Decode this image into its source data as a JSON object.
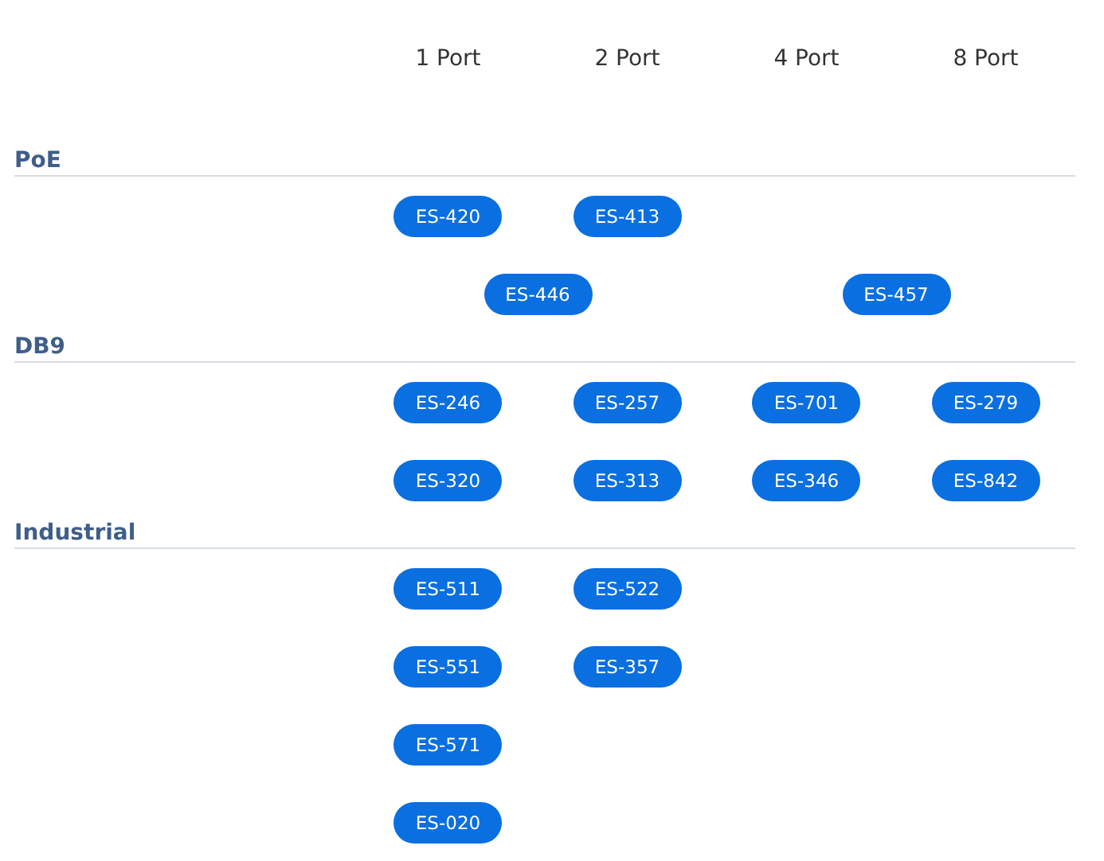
{
  "columns": [
    "1 Port",
    "2 Port",
    "4 Port",
    "8 Port"
  ],
  "sections": [
    {
      "title": "PoE",
      "rows": [
        {
          "cells": [
            {
              "kind": "single",
              "label": "ES-420"
            },
            {
              "kind": "single",
              "label": "ES-413"
            }
          ]
        },
        {
          "cells": [
            {
              "kind": "wide",
              "label": "ES-446"
            },
            {
              "kind": "wide",
              "label": "ES-457"
            }
          ]
        }
      ]
    },
    {
      "title": "DB9",
      "rows": [
        {
          "cells": [
            {
              "kind": "single",
              "label": "ES-246"
            },
            {
              "kind": "single",
              "label": "ES-257"
            },
            {
              "kind": "single",
              "label": "ES-701"
            },
            {
              "kind": "single",
              "label": "ES-279"
            }
          ]
        },
        {
          "cells": [
            {
              "kind": "single",
              "label": "ES-320"
            },
            {
              "kind": "single",
              "label": "ES-313"
            },
            {
              "kind": "single",
              "label": "ES-346"
            },
            {
              "kind": "single",
              "label": "ES-842"
            }
          ]
        }
      ]
    },
    {
      "title": "Industrial",
      "rows": [
        {
          "cells": [
            {
              "kind": "single",
              "label": "ES-511"
            },
            {
              "kind": "single",
              "label": "ES-522"
            }
          ]
        },
        {
          "cells": [
            {
              "kind": "single",
              "label": "ES-551"
            },
            {
              "kind": "single",
              "label": "ES-357"
            }
          ]
        },
        {
          "cells": [
            {
              "kind": "single",
              "label": "ES-571"
            }
          ]
        },
        {
          "cells": [
            {
              "kind": "single",
              "label": "ES-020"
            }
          ]
        }
      ]
    }
  ]
}
